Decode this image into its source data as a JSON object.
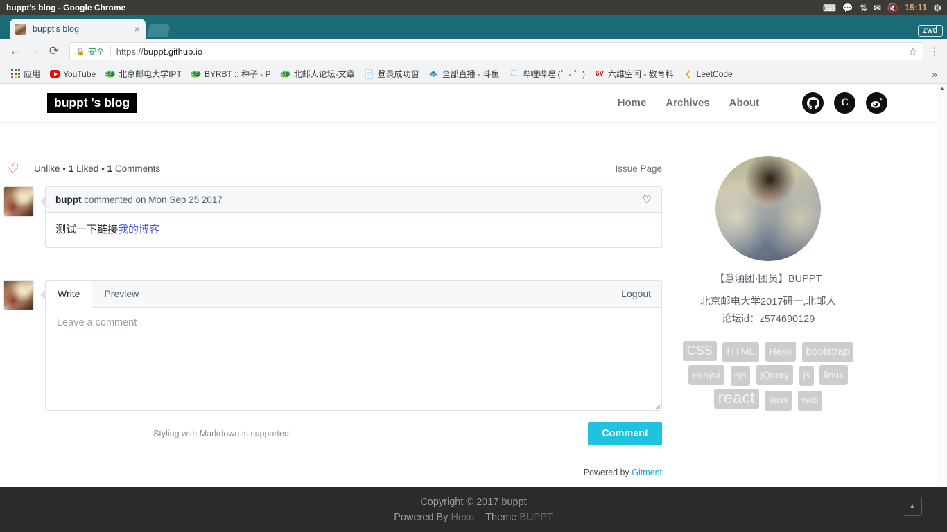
{
  "os": {
    "window_title": "buppt's blog - Google Chrome",
    "tray": {
      "keyboard_icon": "keyboard-icon",
      "wechat_icon": "wechat-icon",
      "network_icon": "network-updown-icon",
      "mail_icon": "mail-icon",
      "volume_icon": "volume-muted-icon",
      "clock": "15:11",
      "power_icon": "power-icon"
    }
  },
  "browser": {
    "tab": {
      "title": "buppt's blog",
      "close_label": "×",
      "favicon": "page-favicon"
    },
    "new_tab_label": "+",
    "profile_label": "zwd",
    "toolbar": {
      "back_icon": "←",
      "forward_icon": "→",
      "reload_icon": "⟳",
      "lock_icon": "🔒",
      "secure_text": "安全",
      "url_scheme": "https://",
      "url_rest": "buppt.github.io",
      "star_icon": "☆",
      "menu_icon": "⋮"
    },
    "bookmarks": [
      {
        "label": "应用",
        "icon": "apps-grid-icon"
      },
      {
        "label": "YouTube",
        "icon": "youtube-icon"
      },
      {
        "label": "北京邮电大学IPT",
        "icon": "firefox-icon"
      },
      {
        "label": "BYRBT :: 种子 - P",
        "icon": "firefox-icon"
      },
      {
        "label": "北邮人论坛-文章",
        "icon": "firefox-icon"
      },
      {
        "label": "登录成功窗",
        "icon": "document-icon"
      },
      {
        "label": "全部直播 - 斗鱼",
        "icon": "douyu-icon"
      },
      {
        "label": "哔哩哔哩 (゜- ゜)",
        "icon": "bilibili-icon"
      },
      {
        "label": "六维空间 - 教育科",
        "icon": "sixsr-icon"
      },
      {
        "label": "LeetCode",
        "icon": "leetcode-icon"
      }
    ],
    "bookmarks_overflow": "»"
  },
  "site": {
    "logo": "buppt 's blog",
    "nav": [
      {
        "label": "Home"
      },
      {
        "label": "Archives"
      },
      {
        "label": "About"
      }
    ],
    "socials": [
      {
        "name": "github-icon",
        "glyph": ""
      },
      {
        "name": "csdn-icon",
        "glyph": "C"
      },
      {
        "name": "weibo-icon",
        "glyph": "◎"
      }
    ]
  },
  "gitment": {
    "like_label": "Unlike",
    "sep": "•",
    "liked_count": "1",
    "liked_label": "Liked",
    "comments_count": "1",
    "comments_label": "Comments",
    "issue_page_label": "Issue Page",
    "comment": {
      "author": "buppt",
      "meta": "commented on Mon Sep 25 2017",
      "body_text": "测试一下链接",
      "body_link": "我的博客",
      "like_icon": "heart-outline-icon"
    },
    "editor": {
      "tab_write": "Write",
      "tab_preview": "Preview",
      "logout_label": "Logout",
      "textarea_placeholder": "Leave a comment",
      "textarea_value": "",
      "markdown_note": "Styling with Markdown is supported",
      "submit_label": "Comment"
    },
    "powered_prefix": "Powered by",
    "powered_link": "Gitment"
  },
  "sidebar": {
    "avatar": "profile-avatar",
    "name": "【意涵团·团员】BUPPT",
    "description_line1": "北京邮电大学2017研一,北邮人",
    "description_line2": "论坛id：z574690129",
    "tags": [
      {
        "label": "CSS",
        "size": 18
      },
      {
        "label": "HTML",
        "size": 15
      },
      {
        "label": "Hexo",
        "size": 14
      },
      {
        "label": "bootstrap",
        "size": 15
      },
      {
        "label": "easyui",
        "size": 14
      },
      {
        "label": "ejs",
        "size": 13
      },
      {
        "label": "jQuery",
        "size": 14
      },
      {
        "label": "js",
        "size": 13
      },
      {
        "label": "linux",
        "size": 14
      },
      {
        "label": "react",
        "size": 24
      },
      {
        "label": "sass",
        "size": 13
      },
      {
        "label": "web",
        "size": 13
      }
    ]
  },
  "footer": {
    "copyright": "Copyright © 2017 buppt",
    "powered_by_prefix": "Powered By",
    "powered_by_name": "Hexo",
    "theme_prefix": "Theme",
    "theme_name": "BUPPT",
    "to_top_icon": "chevron-up-icon"
  },
  "colors": {
    "tabstrip": "#1b6b78",
    "titlebar": "#3c3b37",
    "accent_button": "#1ec3dd",
    "heart_red": "#e5415e",
    "link_blue": "#4a56d6",
    "footer_bg": "#2b2b2b"
  }
}
